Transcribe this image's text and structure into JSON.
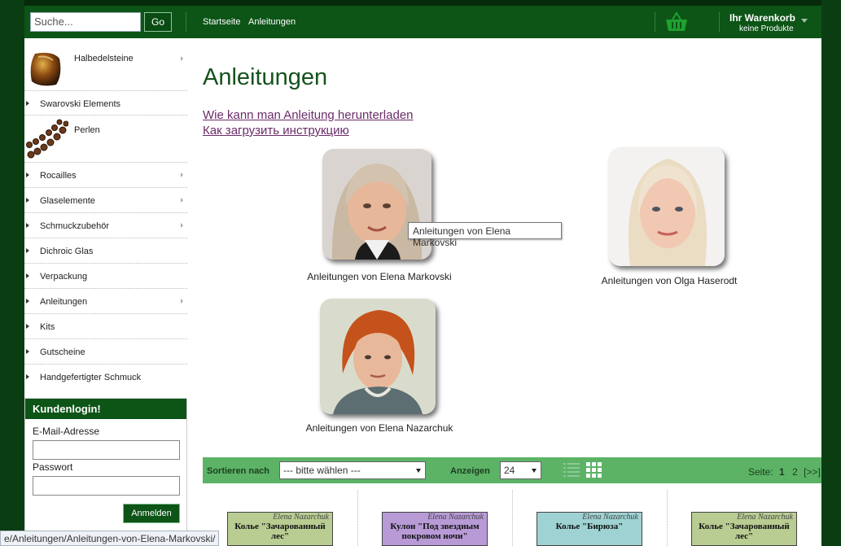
{
  "header": {
    "search_placeholder": "Suche...",
    "go_label": "Go",
    "nav": [
      "Startseite",
      "Anleitungen"
    ],
    "cart_title": "Ihr Warenkorb",
    "cart_subtitle": "keine Produkte"
  },
  "sidebar": {
    "items": [
      {
        "label": "Halbedelsteine",
        "has_sub": true
      },
      {
        "label": "Swarovski Elements",
        "has_sub": false
      },
      {
        "label": "Perlen",
        "has_sub": false
      },
      {
        "label": "Rocailles",
        "has_sub": true
      },
      {
        "label": "Glaselemente",
        "has_sub": true
      },
      {
        "label": "Schmuckzubehör",
        "has_sub": true
      },
      {
        "label": "Dichroic Glas",
        "has_sub": false
      },
      {
        "label": "Verpackung",
        "has_sub": false
      },
      {
        "label": "Anleitungen",
        "has_sub": true
      },
      {
        "label": "Kits",
        "has_sub": false
      },
      {
        "label": "Gutscheine",
        "has_sub": false
      },
      {
        "label": "Handgefertigter Schmuck",
        "has_sub": false
      }
    ]
  },
  "login": {
    "title": "Kundenlogin!",
    "email_label": "E-Mail-Adresse",
    "password_label": "Passwort",
    "submit_label": "Anmelden"
  },
  "main": {
    "title": "Anleitungen",
    "links": [
      "Wie kann man Anleitung herunterladen",
      "Как загрузить инструкцию"
    ],
    "authors": [
      {
        "name": "Anleitungen von Elena Markovski"
      },
      {
        "name": "Anleitungen von Olga Haserodt"
      },
      {
        "name": "Anleitungen von Elena Nazarchuk"
      }
    ],
    "tooltip": "Anleitungen von Elena Markovski"
  },
  "sortbar": {
    "sort_label": "Sortieren nach",
    "sort_value": "--- bitte wählen ---",
    "show_label": "Anzeigen",
    "show_value": "24",
    "page_label": "Seite:",
    "pages": [
      "1",
      "2",
      "[>>]"
    ]
  },
  "products": [
    {
      "signature": "Elena Nazarchuk",
      "title": "Колье \"Зачарованный лес\"",
      "color": "#b9cc92"
    },
    {
      "signature": "Elena Nazarchuk",
      "title": "Кулон \"Под звездным покровом ночи\"",
      "color": "#b79ad6"
    },
    {
      "signature": "Elena Nazarchuk",
      "title": "Колье \"Бирюза\"",
      "color": "#9fd2d2"
    },
    {
      "signature": "Elena Nazarchuk",
      "title": "Колье \"Зачарованный лес\"",
      "color": "#b9cc92"
    }
  ],
  "status_bar": "e/Anleitungen/Anleitungen-von-Elena-Markovski/",
  "colors": {
    "brand_green": "#0d5417",
    "sortbar_green": "#5cb366",
    "link_purple": "#6b2b69"
  }
}
